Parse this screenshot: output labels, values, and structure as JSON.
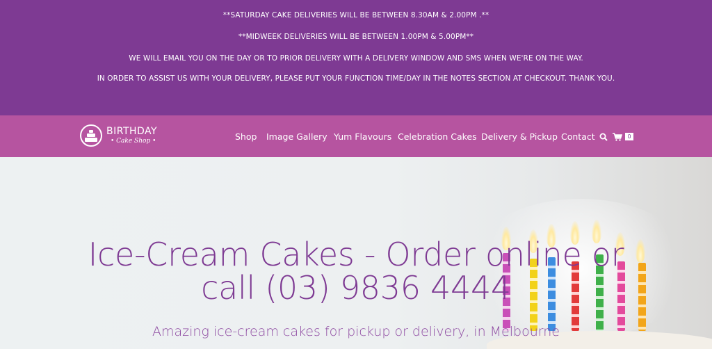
{
  "notices": [
    "**SATURDAY CAKE DELIVERIES WILL BE BETWEEN 8.30AM & 2.00PM .**",
    "**MIDWEEK DELIVERIES WILL BE BETWEEN 1.00PM & 5.00PM**",
    "WE WILL EMAIL YOU ON THE DAY OR TO PRIOR DELIVERY WITH A DELIVERY WINDOW AND SMS WHEN WE'RE ON THE WAY.",
    "IN ORDER TO ASSIST US WITH YOUR DELIVERY, PLEASE PUT YOUR FUNCTION TIME/DAY IN THE NOTES SECTION AT CHECKOUT. THANK YOU."
  ],
  "logo": {
    "title": "BIRTHDAY",
    "subtitle": "• Cake Shop •",
    "icon": "cake-icon"
  },
  "nav": {
    "items": [
      {
        "label": "Shop"
      },
      {
        "label": "Image Gallery"
      },
      {
        "label": "Yum Flavours"
      },
      {
        "label": "Celebration Cakes"
      },
      {
        "label": "Delivery & Pickup"
      },
      {
        "label": "Contact"
      }
    ],
    "search_icon": "search-icon",
    "cart_icon": "cart-icon",
    "cart_count": "0"
  },
  "hero": {
    "title_line1": "Ice-Cream Cakes - Order online or",
    "title_line2": "call (03) 9836 4444",
    "subtitle": "Amazing ice-cream cakes for pickup or delivery, in Melbourne"
  },
  "colors": {
    "notice_bg": "#7e3a93",
    "nav_bg": "#b654a0",
    "accent_text": "#7e3a93"
  }
}
